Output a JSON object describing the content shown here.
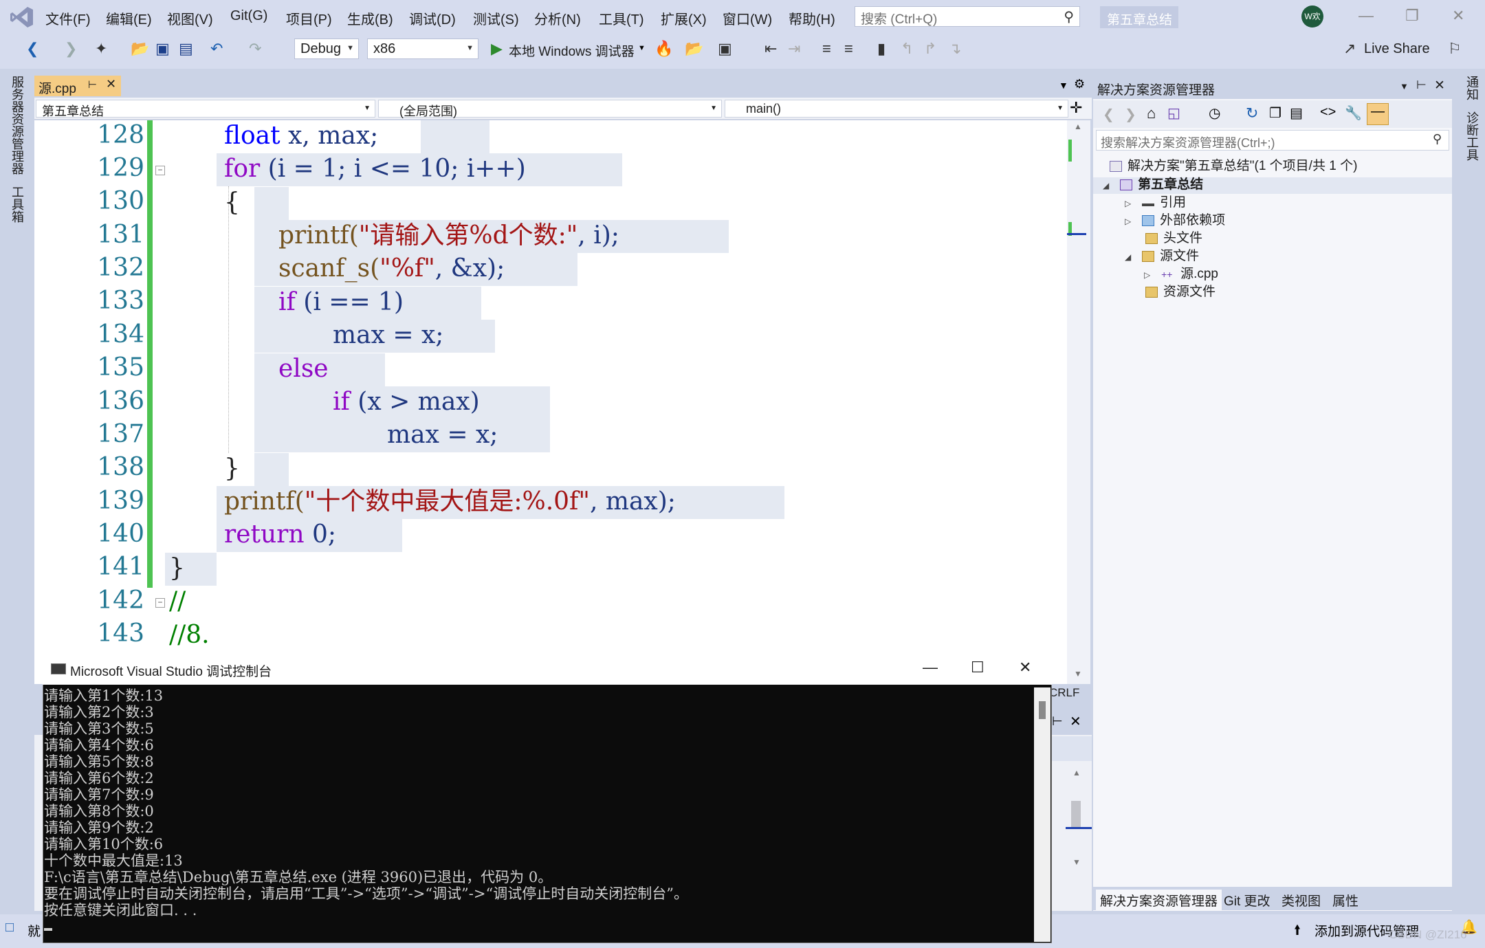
{
  "menu": {
    "items": [
      "文件(F)",
      "编辑(E)",
      "视图(V)",
      "Git(G)",
      "项目(P)",
      "生成(B)",
      "调试(D)",
      "测试(S)",
      "分析(N)",
      "工具(T)",
      "扩展(X)",
      "窗口(W)",
      "帮助(H)"
    ],
    "search_placeholder": "搜索 (Ctrl+Q)",
    "project_badge": "第五章总结",
    "avatar": "W欢"
  },
  "toolbar": {
    "config": "Debug",
    "platform": "x86",
    "run_label": "本地 Windows 调试器",
    "live_share": "Live Share"
  },
  "left_strip": {
    "server_explorer": "服务器资源管理器",
    "toolbox": "工具箱"
  },
  "right_strip": {
    "notifications": "通知",
    "diagnostics": "诊断工具"
  },
  "editor": {
    "tab_name": "源.cpp",
    "nav_project": "第五章总结",
    "nav_scope": "(全局范围)",
    "nav_function": "main()",
    "line_numbers": [
      "128",
      "129",
      "130",
      "131",
      "132",
      "133",
      "134",
      "135",
      "136",
      "137",
      "138",
      "139",
      "140",
      "141",
      "142",
      "143"
    ],
    "line_ending": "CRLF"
  },
  "code": {
    "l128_kw": "float",
    "l128_rest": " x, max;",
    "l129_kw": "for",
    "l129_rest": " (i = 1; i <= 10; i++)",
    "l130": "{",
    "l131_fn": "printf(",
    "l131_str": "\"请输入第%d个数:\"",
    "l131_rest": ", i);",
    "l132_fn": "scanf_s(",
    "l132_str": "\"%f\"",
    "l132_rest": ", &x);",
    "l133_kw": "if",
    "l133_rest": " (i == 1)",
    "l134": "max = x;",
    "l135_kw": "else",
    "l136_kw": "if",
    "l136_rest": " (x > max)",
    "l137": "max = x;",
    "l138": "}",
    "l139_fn": "printf(",
    "l139_str": "\"十个数中最大值是:%.0f\"",
    "l139_rest": ", max);",
    "l140_kw": "return",
    "l140_rest": " 0;",
    "l141": "}",
    "l142": "//",
    "l143": "//8."
  },
  "solution_explorer": {
    "title": "解决方案资源管理器",
    "search_placeholder": "搜索解决方案资源管理器(Ctrl+;)",
    "solution": "解决方案\"第五章总结\"(1 个项目/共 1 个)",
    "project": "第五章总结",
    "references": "引用",
    "external_deps": "外部依赖项",
    "header_files": "头文件",
    "source_files": "源文件",
    "source_cpp": "源.cpp",
    "resource_files": "资源文件",
    "tabs": [
      "解决方案资源管理器",
      "Git 更改",
      "类视图",
      "属性"
    ]
  },
  "console": {
    "title": "Microsoft Visual Studio 调试控制台",
    "lines": [
      "请输入第1个数:13",
      "请输入第2个数:3",
      "请输入第3个数:5",
      "请输入第4个数:6",
      "请输入第5个数:8",
      "请输入第6个数:2",
      "请输入第7个数:9",
      "请输入第8个数:0",
      "请输入第9个数:2",
      "请输入第10个数:6",
      "十个数中最大值是:13",
      "F:\\c语言\\第五章总结\\Debug\\第五章总结.exe (进程 3960)已退出，代码为 0。",
      "要在调试停止时自动关闭控制台，请启用“工具”->“选项”->“调试”->“调试停止时自动关闭控制台”。",
      "按任意键关闭此窗口. . ."
    ]
  },
  "statusbar": {
    "ready": "就",
    "add_source_control": "添加到源代码管理",
    "watermark": "CSDN @ZI216"
  }
}
